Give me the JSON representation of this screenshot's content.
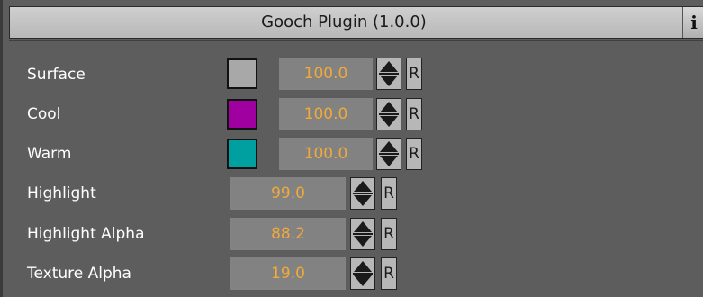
{
  "plugin": {
    "title": "Gooch Plugin (1.0.0)",
    "info_icon": "i"
  },
  "rows": [
    {
      "label": "Surface",
      "color": "#a8a8a8",
      "value": "100.0",
      "reset": "R"
    },
    {
      "label": "Cool",
      "color": "#a000a0",
      "value": "100.0",
      "reset": "R"
    },
    {
      "label": "Warm",
      "color": "#00a0a0",
      "value": "100.0",
      "reset": "R"
    },
    {
      "label": "Highlight",
      "value": "99.0",
      "reset": "R"
    },
    {
      "label": "Highlight Alpha",
      "value": "88.2",
      "reset": "R"
    },
    {
      "label": "Texture Alpha",
      "value": "19.0",
      "reset": "R"
    }
  ]
}
